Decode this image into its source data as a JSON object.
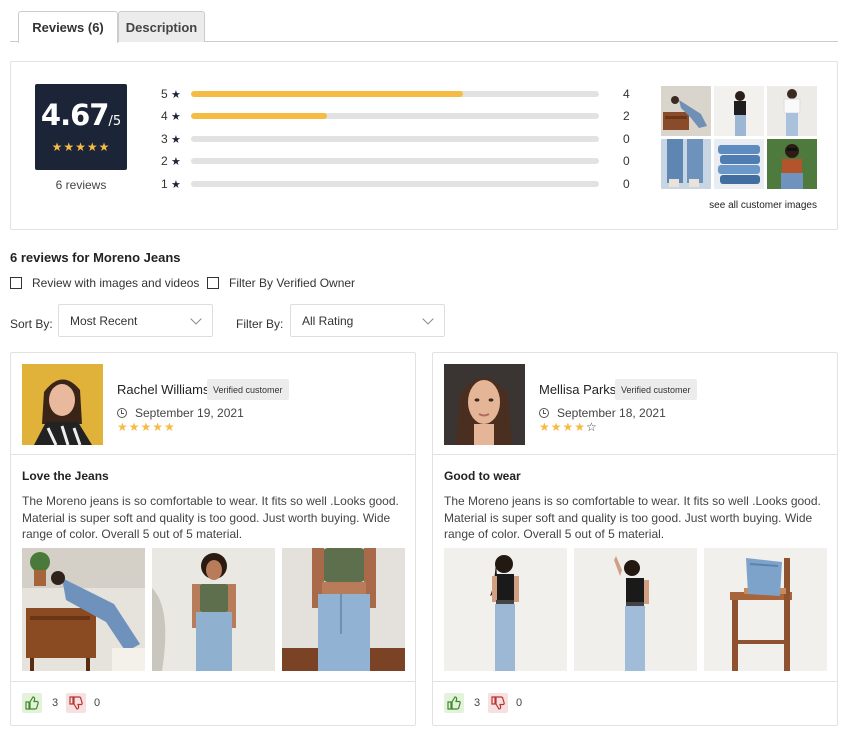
{
  "tabs": [
    {
      "label": "Reviews (6)",
      "active": true
    },
    {
      "label": "Description",
      "active": false
    }
  ],
  "summary": {
    "score": "4.67",
    "out_of": "/5",
    "score_stars": "★★★★★",
    "review_count": "6 reviews",
    "breakdown": [
      {
        "stars": "5",
        "count": "4",
        "fraction": 0.667
      },
      {
        "stars": "4",
        "count": "2",
        "fraction": 0.333
      },
      {
        "stars": "3",
        "count": "0",
        "fraction": 0
      },
      {
        "stars": "2",
        "count": "0",
        "fraction": 0
      },
      {
        "stars": "1",
        "count": "0",
        "fraction": 0
      }
    ],
    "star_glyph": "★",
    "see_all": "see all customer images"
  },
  "reviews_title": "6 reviews for Moreno Jeans",
  "filters": {
    "images_videos": "Review with images and videos",
    "verified_owner": "Filter By Verified Owner",
    "sort_label": "Sort By:",
    "sort_value": "Most Recent",
    "filter_label": "Filter By:",
    "filter_value": "All Rating"
  },
  "reviews": [
    {
      "name": "Rachel Williams",
      "badge": "Verified customer",
      "date": "September 19, 2021",
      "rating": 5,
      "stars_filled": "★★★★★",
      "stars_empty": "",
      "title": "Love the Jeans",
      "body": "The Moreno jeans is so comfortable to wear. It fits so well .Looks good. Material is super soft and quality is too good. Just worth buying. Wide range of color. Overall 5 out of 5 material.",
      "likes": "3",
      "dislikes": "0"
    },
    {
      "name": "Mellisa Parks",
      "badge": "Verified customer",
      "date": "September 18, 2021",
      "rating": 4,
      "stars_filled": "★★★★",
      "stars_empty": "☆",
      "title": "Good to wear",
      "body": "The Moreno jeans is so comfortable to wear. It fits so well .Looks good. Material is super soft and quality is too good. Just worth buying. Wide range of color. Overall 5 out of 5 material.",
      "likes": "3",
      "dislikes": "0"
    }
  ],
  "colors": {
    "accent": "#f6bb42",
    "score_bg": "#1c2537",
    "like_bg": "#e4f2dc",
    "dislike_bg": "#f7e0e0"
  }
}
